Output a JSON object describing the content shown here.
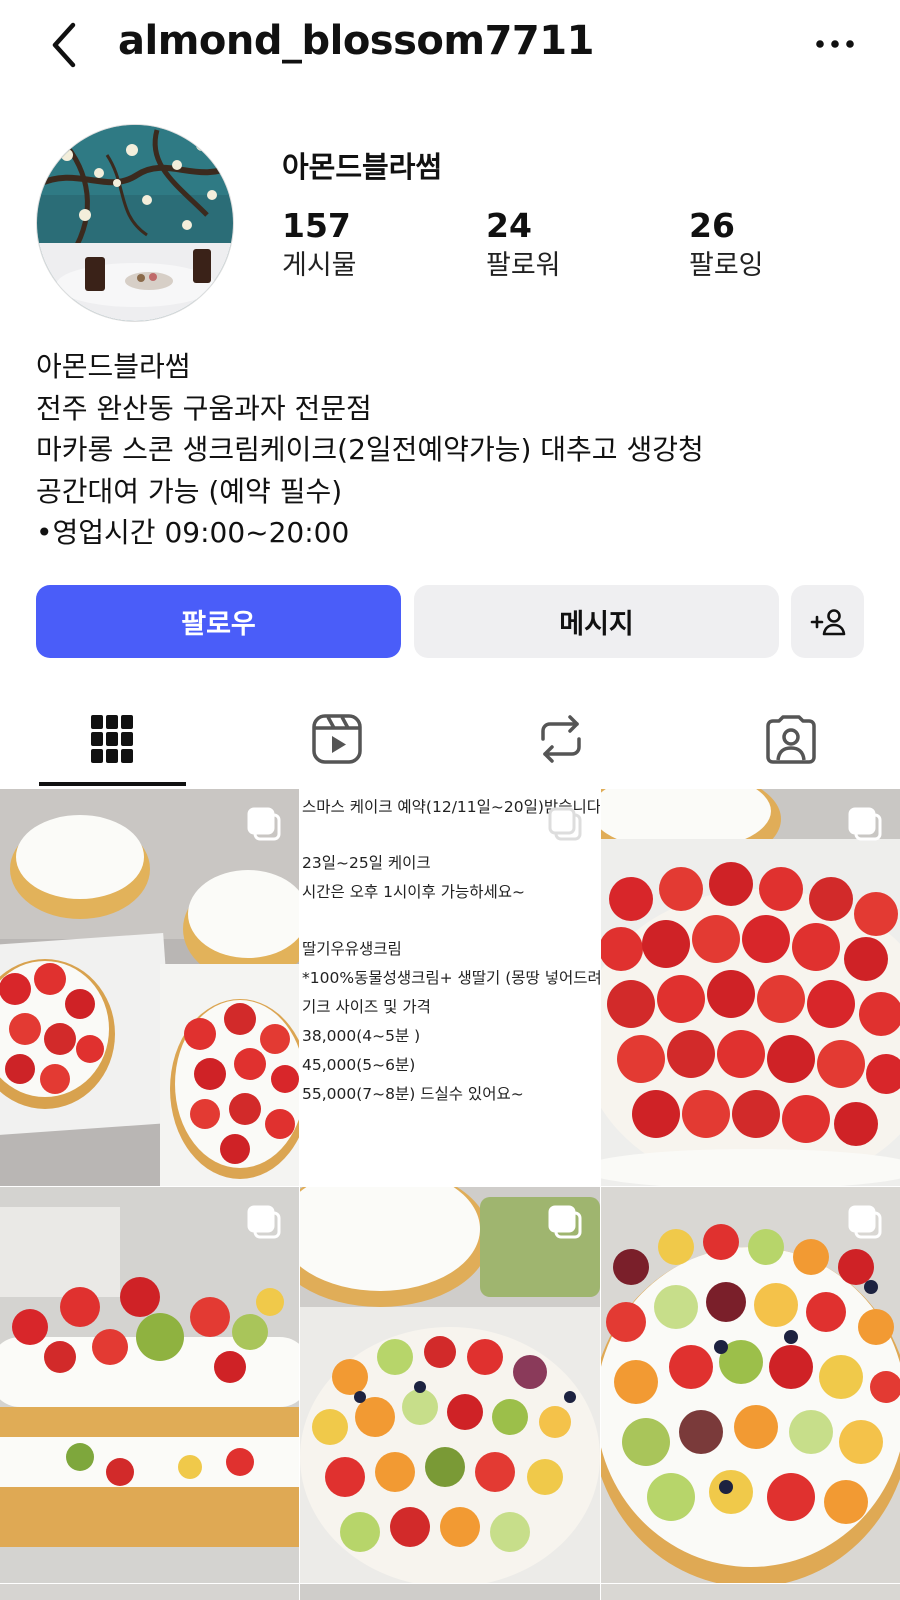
{
  "header": {
    "username": "almond_blossom7711",
    "back_icon": "chevron-left-icon",
    "more_icon": "more-horizontal-icon"
  },
  "profile": {
    "display_name": "아몬드블라썸",
    "stats": {
      "posts_count": "157",
      "posts_label": "게시물",
      "followers_count": "24",
      "followers_label": "팔로워",
      "following_count": "26",
      "following_label": "팔로잉"
    },
    "bio": {
      "line1": "아몬드블라썸",
      "line2": "전주 완산동 구움과자 전문점",
      "line3": "마카롱 스콘 생크림케이크(2일전예약가능) 대추고 생강청",
      "line4": "공간대여 가능 (예약 필수)",
      "line5": "•영업시간 09:00~20:00"
    }
  },
  "actions": {
    "follow_label": "팔로우",
    "message_label": "메시지",
    "suggest_icon": "add-person-icon",
    "colors": {
      "follow_bg": "#4a5df9",
      "secondary_bg": "#efeff1"
    }
  },
  "tabs": [
    {
      "icon": "grid-icon",
      "active": true
    },
    {
      "icon": "reels-icon",
      "active": false
    },
    {
      "icon": "repost-icon",
      "active": false
    },
    {
      "icon": "tagged-icon",
      "active": false
    }
  ],
  "posts": {
    "text_post": {
      "line1": "스마스 케이크 예약(12/11일~20일)받습니다",
      "line2": "23일~25일 케이크",
      "line3": "시간은 오후 1시이후 가능하세요~",
      "line4": "딸기우유생크림",
      "line5": "*100%동물성생크림+ 생딸기 (몽땅 넣어드려",
      "line6": "기크 사이즈 및 가격",
      "line7": "38,000(4~5분 )",
      "line8": "45,000(5~6분)",
      "line9": "55,000(7~8분) 드실수 있어요~"
    }
  }
}
